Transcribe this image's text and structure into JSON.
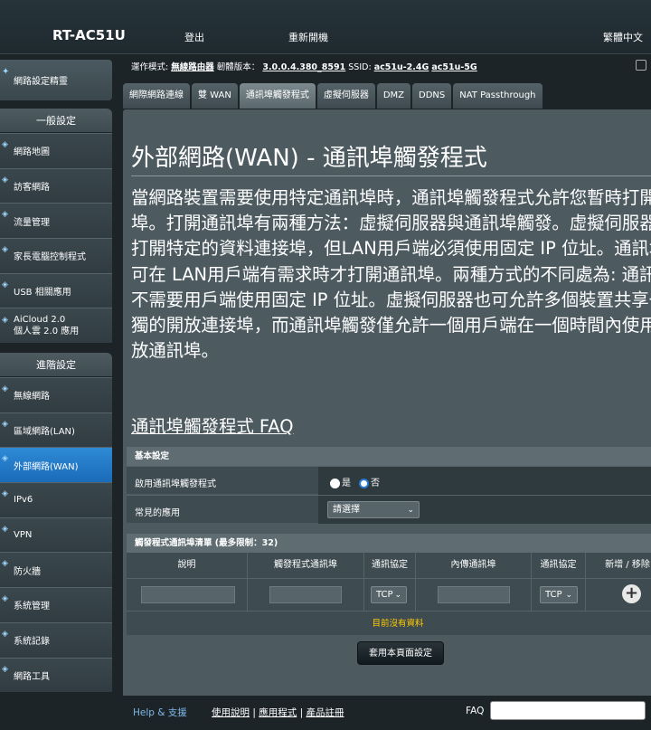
{
  "header": {
    "model": "RT-AC51U",
    "logout": "登出",
    "reboot": "重新開機",
    "language": "繁體中文"
  },
  "sidebar": {
    "quick_setup": "網路設定精靈",
    "general_title": "一般設定",
    "general_items": [
      "網路地圖",
      "訪客網路",
      "流量管理",
      "家長電腦控制程式",
      "USB 相關應用"
    ],
    "aicloud_line1": "AiCloud 2.0",
    "aicloud_line2": "個人雲 2.0 應用",
    "advanced_title": "進階設定",
    "advanced_items": [
      "無線網路",
      "區域網路(LAN)",
      "外部網路(WAN)",
      "IPv6",
      "VPN",
      "防火牆",
      "系統管理",
      "系統記錄",
      "網路工具"
    ]
  },
  "info": {
    "mode_label": "運作模式:",
    "mode_value": "無線路由器",
    "fw_label": "韌體版本：",
    "fw_value": "3.0.0.4.380_8591",
    "ssid_label": "SSID:",
    "ssid1": "ac51u-2.4G",
    "ssid2": "ac51u-5G"
  },
  "tabs": [
    "網際網路連線",
    "雙 WAN",
    "通訊埠觸發程式",
    "虛擬伺服器",
    "DMZ",
    "DDNS",
    "NAT Passthrough"
  ],
  "page": {
    "title": "外部網路(WAN) - 通訊埠觸發程式",
    "description": "當網路裝置需要使用特定通訊埠時，通訊埠觸發程式允許您暫時打開通訊埠。打開通訊埠有兩種方法：虛擬伺服器與通訊埠觸發。虛擬伺服器可全天打開特定的資料連接埠，但LAN用戶端必須使用固定 IP 位址。通訊埠觸發可在 LAN用戶端有需求時才打開通訊埠。兩種方式的不同處為: 通訊埠觸發不需要用戶端使用固定 IP 位址。虛擬伺服器也可允許多個裝置共享一個單獨的開放連接埠，而通訊埠觸發僅允許一個用戶端在一個時間內使用一個開放通訊埠。",
    "faq": "通訊埠觸發程式 FAQ"
  },
  "basic": {
    "title": "基本設定",
    "enable_label": "啟用通訊埠觸發程式",
    "yes": "是",
    "no": "否",
    "app_label": "常見的應用",
    "app_select": "請選擇"
  },
  "trigger_list": {
    "title": "觸發程式通訊埠清單 (最多限制：32)",
    "headers": [
      "說明",
      "觸發程式通訊埠",
      "通訊協定",
      "內傳通訊埠",
      "通訊協定",
      "新增 / 移除"
    ],
    "protocol1": "TCP",
    "protocol2": "TCP",
    "no_data": "目前沒有資料"
  },
  "apply": "套用本頁面設定",
  "footer": {
    "help": "Help & 支援",
    "manual": "使用說明",
    "utility": "應用程式",
    "registration": "產品註冊",
    "sep": "|",
    "faq": "FAQ"
  }
}
